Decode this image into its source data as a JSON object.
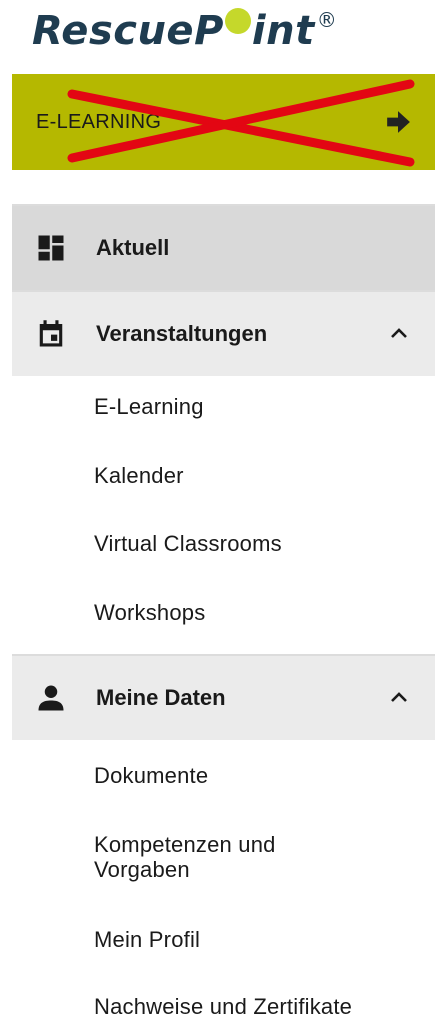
{
  "logo": {
    "part1": "RescueP",
    "part2": "int",
    "registered": "®"
  },
  "banner": {
    "label": "E-LEARNING",
    "arrow_icon": "arrow-right-icon",
    "overlay": "red-cross-out",
    "background": "#b5b800",
    "cross_color": "#e30613"
  },
  "nav": {
    "aktuell": {
      "label": "Aktuell",
      "icon": "dashboard-icon"
    },
    "veranstaltungen": {
      "label": "Veranstaltungen",
      "icon": "calendar-icon",
      "expanded": true,
      "items": [
        "E-Learning",
        "Kalender",
        "Virtual Classrooms",
        "Workshops"
      ]
    },
    "meine_daten": {
      "label": "Meine Daten",
      "icon": "person-icon",
      "expanded": true,
      "items": [
        "Dokumente",
        "Kompetenzen und Vorgaben",
        "Mein Profil",
        "Nachweise und Zertifikate"
      ]
    }
  }
}
